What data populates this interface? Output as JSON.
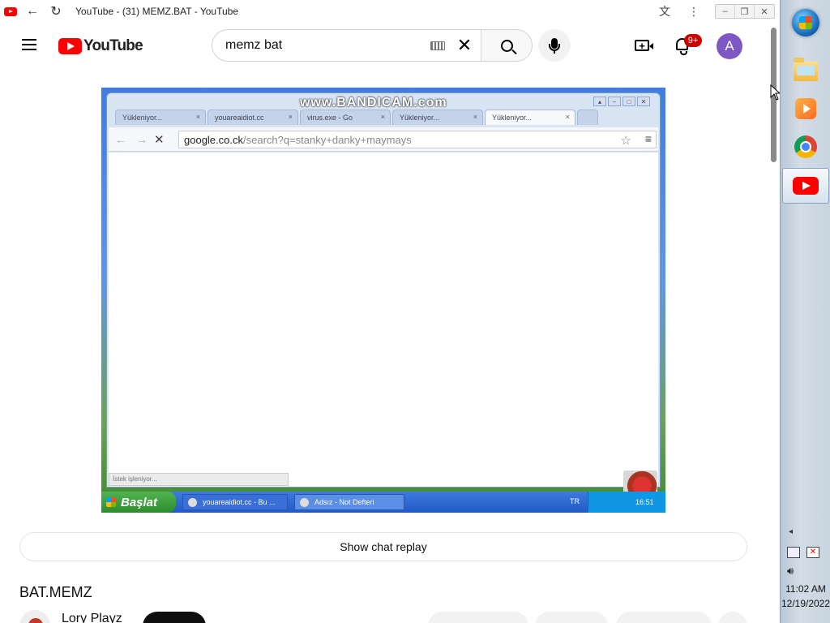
{
  "browser": {
    "tab_title": "YouTube - (31) MEMZ.BAT - YouTube",
    "back_icon": "arrow-left-icon",
    "reload_icon": "reload-icon",
    "translate_icon": "translate-icon",
    "menu_icon": "kebab-icon"
  },
  "header": {
    "logo_text": "YouTube",
    "search_value": "memz bat",
    "notifications_badge": "9+",
    "avatar_initial": "A",
    "avatar_color": "#7e57c2"
  },
  "video": {
    "inner_browser": {
      "watermark": "www.BANDICAM.com",
      "tabs": [
        {
          "label": "Yükleniyor...",
          "close": "×"
        },
        {
          "label": "youareaidiot.cc",
          "close": "×"
        },
        {
          "label": "virus.exe - Go",
          "close": "×"
        },
        {
          "label": "Yükleniyor...",
          "close": "×"
        },
        {
          "label": "Yükleniyor...",
          "close": "×"
        }
      ],
      "url_host": "google.co.ck",
      "url_path": "/search?q=stanky+danky+maymays",
      "status_text": "İstek işleniyor..."
    },
    "xp_taskbar": {
      "start_label": "Başlat",
      "tasks": [
        "youareaidiot.cc - Bu ...",
        "Adsız - Not Defteri"
      ],
      "lang": "TR",
      "clock": "16:51"
    }
  },
  "below_video": {
    "chat_replay_label": "Show chat replay",
    "video_title": "BAT.MEMZ",
    "channel_name": "Lory Playz"
  },
  "win7_taskbar": {
    "apps": [
      "folder-icon",
      "media-player-icon",
      "chrome-icon",
      "youtube-icon"
    ],
    "time": "11:02 AM",
    "date": "12/19/2022"
  }
}
